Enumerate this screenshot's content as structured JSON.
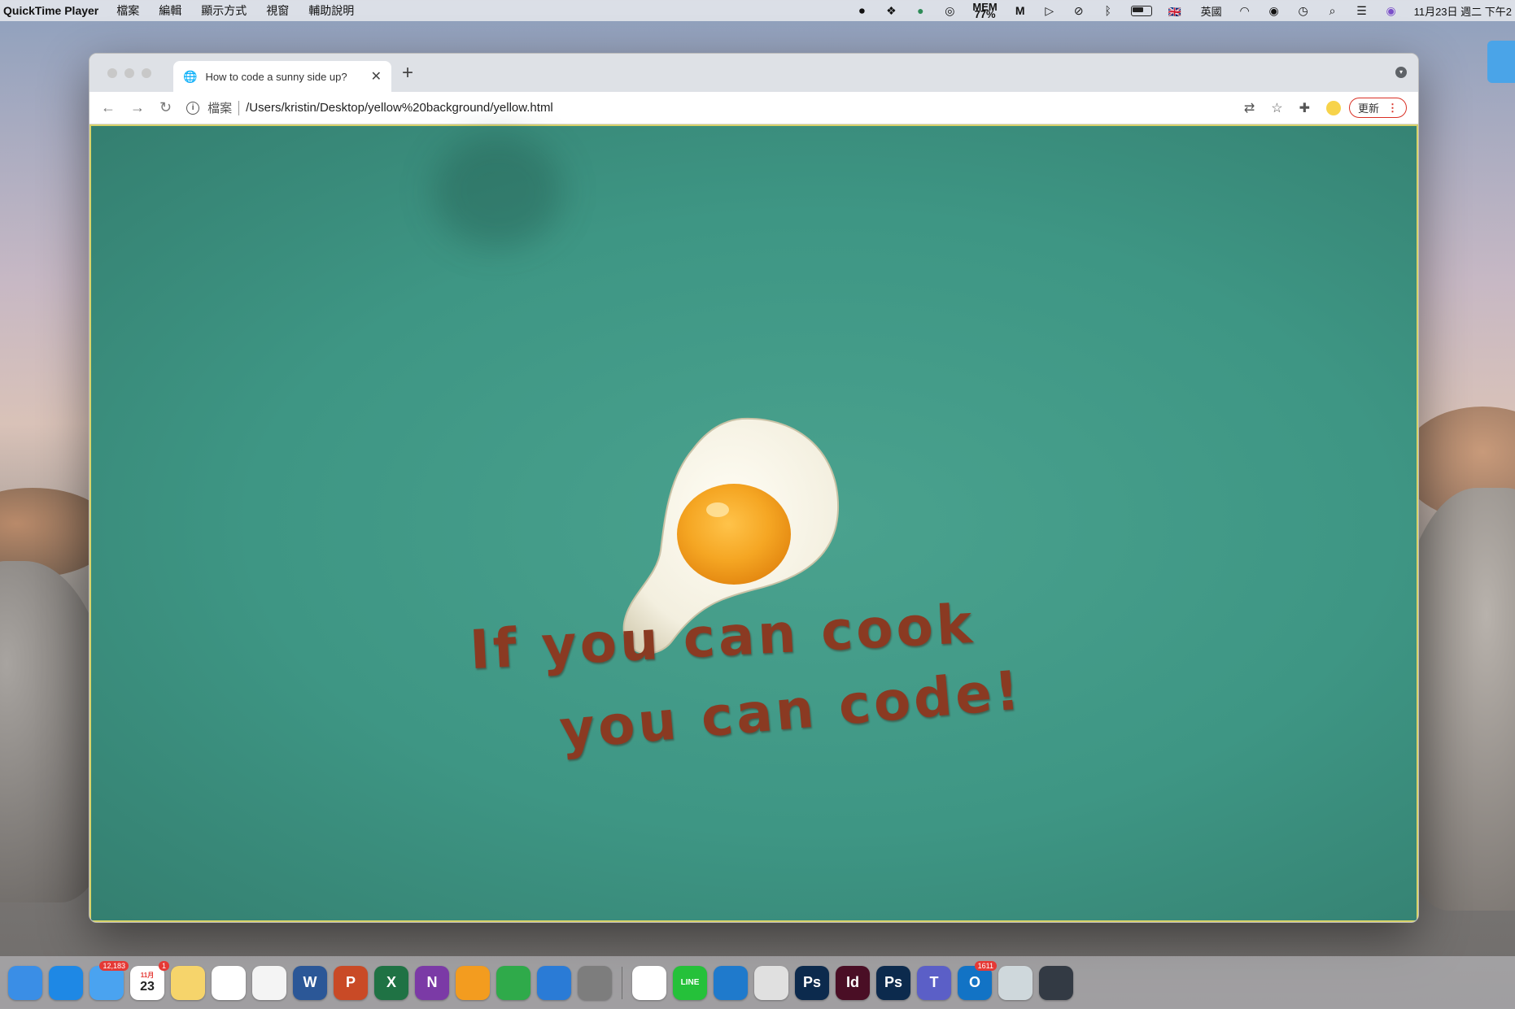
{
  "menubar": {
    "app_name": "QuickTime Player",
    "menus": [
      "檔案",
      "編輯",
      "顯示方式",
      "視窗",
      "輔助說明"
    ],
    "mem_label": "MEM",
    "mem_value": "77%",
    "input_source": "英國",
    "datetime": "11月23日 週二 下午2"
  },
  "browser": {
    "tab_title": "How to code a sunny side up?",
    "new_tab_label": "+",
    "scheme_label": "檔案",
    "url": "/Users/kristin/Desktop/yellow%20background/yellow.html",
    "update_button_label": "更新"
  },
  "content": {
    "line1": "If you can cook",
    "line2": "you can code!",
    "background_color": "#3e9684",
    "text_color": "#8a3a22"
  },
  "dock": {
    "mail_badge": "12,183",
    "calendar_month": "11月",
    "calendar_day": "23",
    "calendar_badge": "1",
    "outlook_badge": "1611",
    "apps": [
      {
        "name": "finder",
        "label": "",
        "color": "#3a8ee6"
      },
      {
        "name": "safari",
        "label": "",
        "color": "#1e88e5"
      },
      {
        "name": "mail",
        "label": "",
        "color": "#4aa3f0"
      },
      {
        "name": "calendar",
        "label": "",
        "color": "#ffffff"
      },
      {
        "name": "notes",
        "label": "",
        "color": "#f6d46b"
      },
      {
        "name": "reminders",
        "label": "",
        "color": "#ffffff"
      },
      {
        "name": "photos",
        "label": "",
        "color": "#f4f4f4"
      },
      {
        "name": "word",
        "label": "W",
        "color": "#2b5797"
      },
      {
        "name": "powerpoint",
        "label": "P",
        "color": "#c94a26"
      },
      {
        "name": "excel",
        "label": "X",
        "color": "#1f7244"
      },
      {
        "name": "onenote",
        "label": "N",
        "color": "#7b3aa6"
      },
      {
        "name": "pages",
        "label": "",
        "color": "#f39c1f"
      },
      {
        "name": "numbers",
        "label": "",
        "color": "#2faa4a"
      },
      {
        "name": "keynote",
        "label": "",
        "color": "#2a7bd6"
      },
      {
        "name": "system-preferences",
        "label": "",
        "color": "#7d7d7d"
      },
      {
        "name": "chrome",
        "label": "",
        "color": "#ffffff"
      },
      {
        "name": "line",
        "label": "LINE",
        "color": "#25c13a"
      },
      {
        "name": "vscode",
        "label": "",
        "color": "#1f7acc"
      },
      {
        "name": "printer",
        "label": "",
        "color": "#e0e0e0"
      },
      {
        "name": "photoshop",
        "label": "Ps",
        "color": "#0c2a4d"
      },
      {
        "name": "indesign",
        "label": "Id",
        "color": "#4a0e25"
      },
      {
        "name": "photoshop-2",
        "label": "Ps",
        "color": "#0c2a4d"
      },
      {
        "name": "teams",
        "label": "T",
        "color": "#5b5fc7"
      },
      {
        "name": "outlook",
        "label": "O",
        "color": "#1273c5"
      },
      {
        "name": "preview",
        "label": "",
        "color": "#cfd8dc"
      },
      {
        "name": "quicktime",
        "label": "",
        "color": "#333a44"
      }
    ]
  }
}
